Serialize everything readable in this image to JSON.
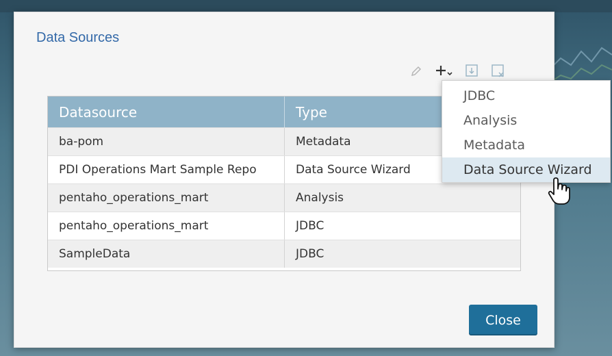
{
  "dialog": {
    "title": "Data Sources",
    "toolbar": {
      "edit_icon": "pencil-icon",
      "add_icon": "plus-dropdown-icon",
      "import_icon": "import-icon",
      "delete_icon": "delete-icon"
    },
    "table": {
      "columns": [
        "Datasource",
        "Type"
      ],
      "rows": [
        {
          "name": "ba-pom",
          "type": "Metadata"
        },
        {
          "name": "PDI Operations Mart Sample Repo",
          "type": "Data Source Wizard"
        },
        {
          "name": "pentaho_operations_mart",
          "type": "Analysis"
        },
        {
          "name": "pentaho_operations_mart",
          "type": "JDBC"
        },
        {
          "name": "SampleData",
          "type": "JDBC"
        }
      ]
    },
    "close_label": "Close"
  },
  "add_menu": {
    "items": [
      "JDBC",
      "Analysis",
      "Metadata",
      "Data Source Wizard"
    ],
    "highlighted": "Data Source Wizard"
  },
  "colors": {
    "header": "#8fb3c8",
    "title": "#3369a8",
    "button": "#1f6f9a"
  }
}
